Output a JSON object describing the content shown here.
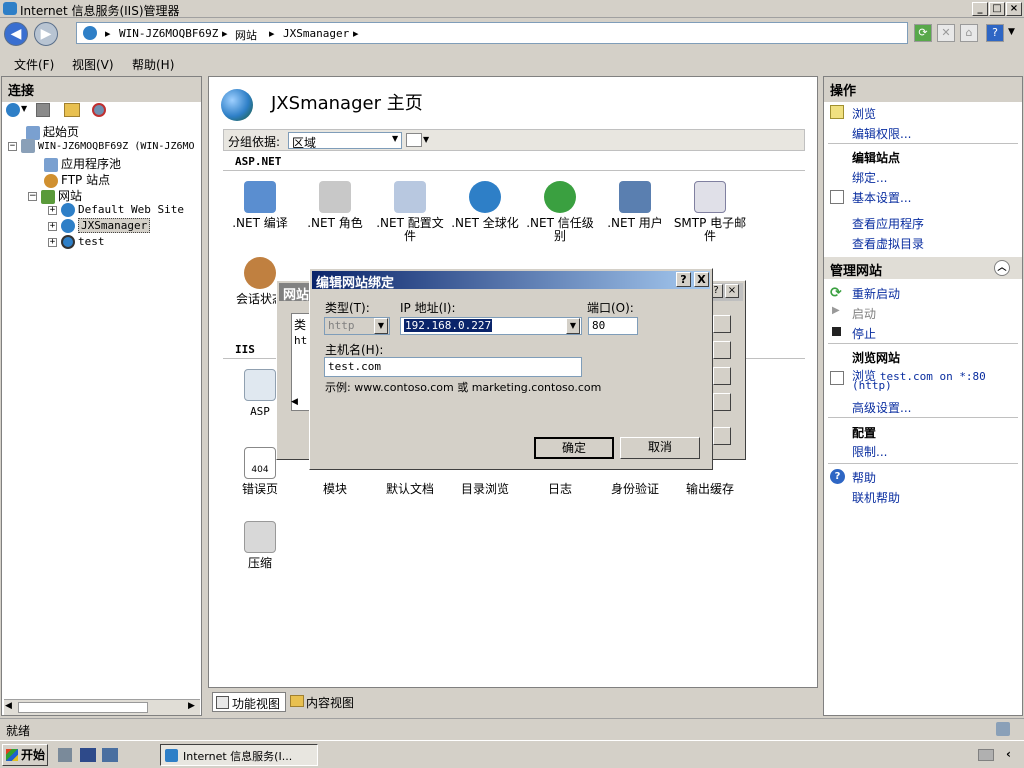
{
  "window": {
    "title": "Internet 信息服务(IIS)管理器"
  },
  "address": {
    "crumbs": [
      "WIN-JZ6MOQBF69Z",
      "网站",
      "JXSmanager"
    ]
  },
  "menu": [
    "文件(F)",
    "视图(V)",
    "帮助(H)"
  ],
  "connections": {
    "header": "连接",
    "tree": {
      "start_page": "起始页",
      "server": "WIN-JZ6MOQBF69Z (WIN-JZ6MO",
      "app_pools": "应用程序池",
      "ftp_sites": "FTP 站点",
      "sites": "网站",
      "default_site": "Default Web Site",
      "jxsmanager": "JXSmanager",
      "test": "test"
    }
  },
  "main": {
    "title": "JXSmanager 主页",
    "group_label": "分组依据:",
    "group_value": "区域",
    "section_aspnet": "ASP.NET",
    "section_iis": "IIS",
    "features_aspnet": [
      {
        "l1": ".NET 编译",
        "l2": ""
      },
      {
        "l1": ".NET 角色",
        "l2": ""
      },
      {
        "l1": ".NET 配置文",
        "l2": "件"
      },
      {
        "l1": ".NET 全球化",
        "l2": ""
      },
      {
        "l1": ".NET 信任级",
        "l2": "别"
      },
      {
        "l1": ".NET 用户",
        "l2": ""
      },
      {
        "l1": "SMTP 电子邮",
        "l2": "件"
      }
    ],
    "feature_session": "会话状态",
    "feature_asp": "ASP",
    "features_row3": [
      "错误页",
      "模块",
      "默认文档",
      "目录浏览",
      "日志",
      "身份验证",
      "输出缓存"
    ],
    "feature_compress": "压缩",
    "tab_feature_view": "功能视图",
    "tab_content_view": "内容视图"
  },
  "bg_dialog": {
    "title": "网站",
    "col_type": "类",
    "row_type": "ht"
  },
  "dialog": {
    "title": "编辑网站绑定",
    "type_label": "类型(T):",
    "type_value": "http",
    "ip_label": "IP 地址(I):",
    "ip_value": "192.168.0.227",
    "port_label": "端口(O):",
    "port_value": "80",
    "host_label": "主机名(H):",
    "host_value": "test.com",
    "example": "示例: www.contoso.com 或 marketing.contoso.com",
    "ok": "确定",
    "cancel": "取消",
    "help_btn": "?",
    "close_btn": "X"
  },
  "actions": {
    "header": "操作",
    "browse": "浏览",
    "edit_perms": "编辑权限...",
    "edit_site_hdr": "编辑站点",
    "bindings": "绑定...",
    "basic_settings": "基本设置...",
    "view_apps": "查看应用程序",
    "view_vdirs": "查看虚拟目录",
    "manage_site_hdr": "管理网站",
    "restart": "重新启动",
    "start": "启动",
    "stop": "停止",
    "browse_site_hdr": "浏览网站",
    "browse_prefix": "浏览",
    "browse_target": "test.com on *:80",
    "browse_suffix": "(http)",
    "advanced": "高级设置...",
    "config_hdr": "配置",
    "limits": "限制...",
    "help": "帮助",
    "online_help": "联机帮助"
  },
  "status": {
    "text": "就绪"
  },
  "taskbar": {
    "start": "开始",
    "task": "Internet 信息服务(I..."
  },
  "colors": {
    "globe": "#2e7fc7",
    "dialog_title": "#0a246a",
    "link": "#0a2ea0"
  }
}
